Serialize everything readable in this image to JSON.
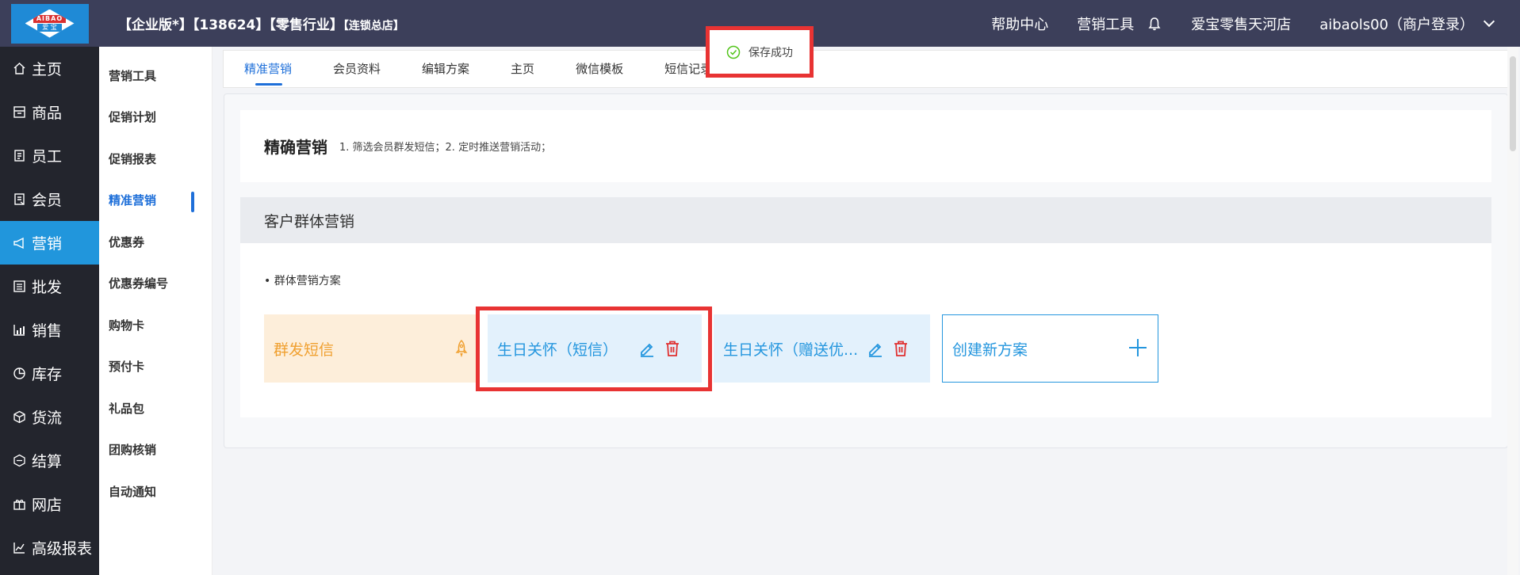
{
  "header": {
    "logo_top": "AIBAO",
    "logo_bottom": "爱 宝",
    "edition": "【企业版*】【138624】【零售行业】",
    "store_type": "【连锁总店】",
    "help": "帮助中心",
    "marketing_tools": "营销工具",
    "store_name": "爱宝零售天河店",
    "user": "aibaols00（商户登录）"
  },
  "leftnav": [
    {
      "label": "主页",
      "icon": "home-icon"
    },
    {
      "label": "商品",
      "icon": "goods-icon"
    },
    {
      "label": "员工",
      "icon": "staff-icon"
    },
    {
      "label": "会员",
      "icon": "member-icon"
    },
    {
      "label": "营销",
      "icon": "megaphone-icon",
      "active": true
    },
    {
      "label": "批发",
      "icon": "wholesale-icon"
    },
    {
      "label": "销售",
      "icon": "sales-chart-icon"
    },
    {
      "label": "库存",
      "icon": "stock-pie-icon"
    },
    {
      "label": "货流",
      "icon": "logistics-icon"
    },
    {
      "label": "结算",
      "icon": "settlement-icon"
    },
    {
      "label": "网店",
      "icon": "gift-store-icon"
    },
    {
      "label": "高级报表",
      "icon": "report-line-icon"
    }
  ],
  "subnav": [
    "营销工具",
    "促销计划",
    "促销报表",
    "精准营销",
    "优惠券",
    "优惠券编号",
    "购物卡",
    "预付卡",
    "礼品包",
    "团购核销",
    "自动通知"
  ],
  "subnav_active_index": 3,
  "tabs": [
    "精准营销",
    "会员资料",
    "编辑方案",
    "主页",
    "微信模板",
    "短信记录"
  ],
  "active_tab": 0,
  "toast": {
    "text": "保存成功"
  },
  "intro": {
    "title": "精确营销",
    "desc": "1. 筛选会员群发短信；2. 定时推送营销活动；"
  },
  "group": {
    "title": "客户群体营销",
    "subtitle": "• 群体营销方案",
    "cards": {
      "sms": "群发短信",
      "birthday_sms": "生日关怀（短信）",
      "birthday_gift": "生日关怀（赠送优...",
      "create_new": "创建新方案"
    }
  },
  "colors": {
    "topbar": "#3c3f5a",
    "leftnav": "#23252d",
    "active_nav": "#2196dc",
    "accent": "#1e6fd9",
    "highlight": "#e83333",
    "sms_bg": "#fdeeda",
    "sms_text": "#f0a030",
    "card_bg": "#e3f1fc",
    "card_text": "#2496de",
    "delete": "#e03030"
  }
}
